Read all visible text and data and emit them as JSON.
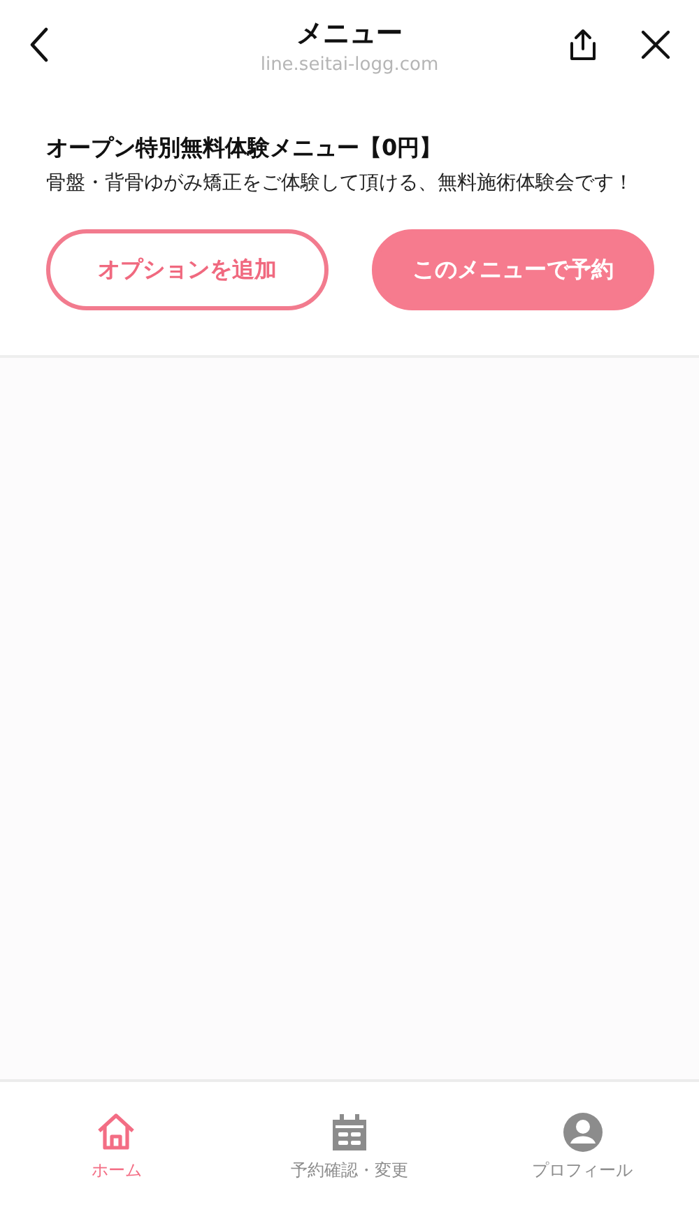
{
  "header": {
    "title": "メニュー",
    "url": "line.seitai-logg.com"
  },
  "menu": {
    "title": "オープン特別無料体験メニュー【0円】",
    "description": "骨盤・背骨ゆがみ矯正をご体験して頂ける、無料施術体験会です！",
    "buttons": [
      {
        "label": "オプションを追加",
        "kind": "outline"
      },
      {
        "label": "このメニューで予約",
        "kind": "filled"
      }
    ]
  },
  "tabs": [
    {
      "label": "ホーム",
      "selected": true
    },
    {
      "label": "予約確認・変更",
      "selected": false
    },
    {
      "label": "プロフィール",
      "selected": false
    }
  ]
}
